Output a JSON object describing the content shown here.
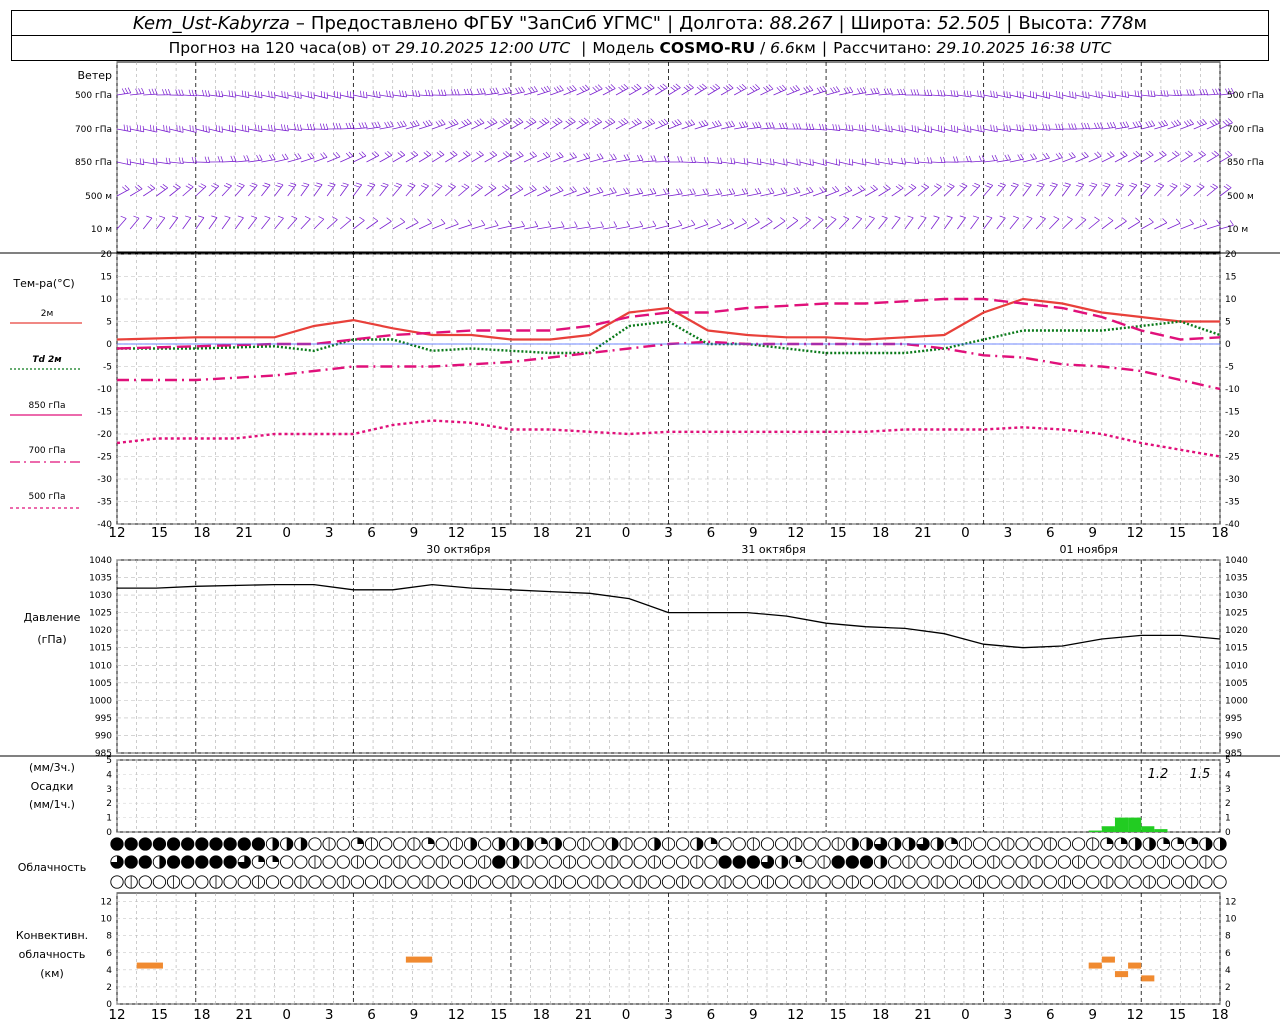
{
  "header": {
    "station": "Kem_Ust-Kabyrza",
    "provider": "Предоставлено ФГБУ \"ЗапСиб УГМС\"",
    "lon_label": "Долгота:",
    "lon": "88.267",
    "lat_label": "Широта:",
    "lat": "52.505",
    "alt_label": "Высота:",
    "alt": "778",
    "alt_unit": "м",
    "forecast_prefix": "Прогноз на 120 часа(ов) от",
    "forecast_start": "29.10.2025 12:00 UTC",
    "model_prefix": "Модель",
    "model": "COSMO-RU",
    "model_res": "6.6",
    "model_res_unit": "км",
    "computed_label": "Рассчитано:",
    "computed": "29.10.2025 16:38 UTC"
  },
  "wind_panel": {
    "title": "Ветер",
    "levels": [
      "500 гПа",
      "700 гПа",
      "850 гПа",
      "500 м",
      "10 м"
    ],
    "barb_color": "#7a1fd0"
  },
  "temp_panel": {
    "title": "Тем-ра(°С)",
    "legend": [
      {
        "label": "2м",
        "color": "#e8403a",
        "style": "solid"
      },
      {
        "label": "Td 2м",
        "color": "#0a7a1a",
        "style": "dotted"
      },
      {
        "label": "850 гПа",
        "color": "#e0107a",
        "style": "long-dash"
      },
      {
        "label": "700 гПа",
        "color": "#e0107a",
        "style": "dash-dot"
      },
      {
        "label": "500 гПа",
        "color": "#e0107a",
        "style": "short-dash"
      }
    ]
  },
  "pressure_panel": {
    "title": "Давление",
    "unit": "(гПа)"
  },
  "precip_panel": {
    "unit_top": "(мм/3ч.)",
    "title": "Осадки",
    "unit_bottom": "(мм/1ч.)",
    "annotations": [
      "1.2",
      "1.5"
    ],
    "bar_color": "#22cc22"
  },
  "cloud_panel": {
    "title": "Облачность"
  },
  "conv_panel": {
    "title_lines": [
      "Конвективн.",
      "облачность",
      "(км)"
    ],
    "bar_color": "#f08a30"
  },
  "time_axis": {
    "hour_ticks": [
      "12",
      "15",
      "18",
      "21",
      "0",
      "3",
      "6",
      "9",
      "12",
      "15",
      "18",
      "21",
      "0",
      "3",
      "6",
      "9",
      "12",
      "15",
      "18",
      "21",
      "0",
      "3",
      "6",
      "9",
      "12",
      "15",
      "18"
    ],
    "dates": [
      {
        "label": "30 октября",
        "at_hour": 24
      },
      {
        "label": "31 октября",
        "at_hour": 48
      },
      {
        "label": "01 ноября",
        "at_hour": 72
      }
    ]
  },
  "chart_data": [
    {
      "type": "line",
      "id": "temperature",
      "ylim": [
        -40,
        20
      ],
      "y_ticks": [
        20,
        15,
        10,
        5,
        0,
        -5,
        -10,
        -15,
        -20,
        -25,
        -30,
        -35,
        -40
      ],
      "x_unit": "hours since 29.10.2025 12:00 UTC",
      "series": [
        {
          "name": "2м",
          "color": "#e8403a",
          "style": "solid",
          "points": [
            [
              0,
              1
            ],
            [
              12,
              1.5
            ],
            [
              24,
              1.5
            ],
            [
              30,
              4
            ],
            [
              36,
              5.3
            ],
            [
              42,
              3.5
            ],
            [
              48,
              2
            ],
            [
              54,
              2
            ],
            [
              60,
              1
            ],
            [
              66,
              1
            ],
            [
              72,
              2
            ],
            [
              78,
              7
            ],
            [
              84,
              8
            ],
            [
              90,
              3
            ],
            [
              96,
              2
            ],
            [
              102,
              1.5
            ],
            [
              108,
              1.5
            ],
            [
              114,
              1
            ],
            [
              120,
              1.5
            ],
            [
              126,
              2
            ],
            [
              132,
              7
            ],
            [
              138,
              10
            ],
            [
              144,
              9
            ],
            [
              150,
              7
            ],
            [
              156,
              6
            ],
            [
              162,
              5
            ],
            [
              168,
              5
            ]
          ]
        },
        {
          "name": "Td 2м",
          "color": "#0a7a1a",
          "style": "dotted",
          "points": [
            [
              0,
              -1
            ],
            [
              12,
              -1
            ],
            [
              24,
              -0.5
            ],
            [
              30,
              -1.5
            ],
            [
              36,
              1
            ],
            [
              42,
              1
            ],
            [
              48,
              -1.5
            ],
            [
              54,
              -1
            ],
            [
              60,
              -1.5
            ],
            [
              66,
              -2
            ],
            [
              72,
              -2
            ],
            [
              78,
              4
            ],
            [
              84,
              5
            ],
            [
              90,
              0
            ],
            [
              96,
              0
            ],
            [
              102,
              -1
            ],
            [
              108,
              -2
            ],
            [
              114,
              -2
            ],
            [
              120,
              -2
            ],
            [
              126,
              -1
            ],
            [
              132,
              1
            ],
            [
              138,
              3
            ],
            [
              144,
              3
            ],
            [
              150,
              3
            ],
            [
              156,
              4
            ],
            [
              162,
              5
            ],
            [
              168,
              2
            ]
          ]
        },
        {
          "name": "850 гПа",
          "color": "#e0107a",
          "style": "long-dash",
          "points": [
            [
              0,
              -1
            ],
            [
              12,
              -0.5
            ],
            [
              24,
              0
            ],
            [
              30,
              0
            ],
            [
              36,
              1
            ],
            [
              42,
              2
            ],
            [
              48,
              2.5
            ],
            [
              54,
              3
            ],
            [
              60,
              3
            ],
            [
              66,
              3
            ],
            [
              72,
              4
            ],
            [
              78,
              6
            ],
            [
              84,
              7
            ],
            [
              90,
              7
            ],
            [
              96,
              8
            ],
            [
              102,
              8.5
            ],
            [
              108,
              9
            ],
            [
              114,
              9
            ],
            [
              120,
              9.5
            ],
            [
              126,
              10
            ],
            [
              132,
              10
            ],
            [
              138,
              9
            ],
            [
              144,
              8
            ],
            [
              150,
              6
            ],
            [
              156,
              3
            ],
            [
              162,
              1
            ],
            [
              168,
              1.5
            ]
          ]
        },
        {
          "name": "700 гПа",
          "color": "#e0107a",
          "style": "dash-dot",
          "points": [
            [
              0,
              -8
            ],
            [
              12,
              -8
            ],
            [
              24,
              -7
            ],
            [
              30,
              -6
            ],
            [
              36,
              -5
            ],
            [
              42,
              -5
            ],
            [
              48,
              -5
            ],
            [
              54,
              -4.5
            ],
            [
              60,
              -4
            ],
            [
              66,
              -3
            ],
            [
              72,
              -2
            ],
            [
              78,
              -1
            ],
            [
              84,
              0
            ],
            [
              90,
              0.5
            ],
            [
              96,
              0
            ],
            [
              102,
              0
            ],
            [
              108,
              0
            ],
            [
              114,
              0
            ],
            [
              120,
              0
            ],
            [
              126,
              -1
            ],
            [
              132,
              -2.5
            ],
            [
              138,
              -3
            ],
            [
              144,
              -4.5
            ],
            [
              150,
              -5
            ],
            [
              156,
              -6
            ],
            [
              162,
              -8
            ],
            [
              168,
              -10
            ]
          ]
        },
        {
          "name": "500 гПа",
          "color": "#e0107a",
          "style": "short-dash",
          "points": [
            [
              0,
              -22
            ],
            [
              6,
              -21
            ],
            [
              12,
              -21
            ],
            [
              18,
              -21
            ],
            [
              24,
              -20
            ],
            [
              30,
              -20
            ],
            [
              36,
              -20
            ],
            [
              42,
              -18
            ],
            [
              48,
              -17
            ],
            [
              54,
              -17.5
            ],
            [
              60,
              -19
            ],
            [
              66,
              -19
            ],
            [
              72,
              -19.5
            ],
            [
              78,
              -20
            ],
            [
              84,
              -19.5
            ],
            [
              90,
              -19.5
            ],
            [
              96,
              -19.5
            ],
            [
              102,
              -19.5
            ],
            [
              108,
              -19.5
            ],
            [
              114,
              -19.5
            ],
            [
              120,
              -19
            ],
            [
              126,
              -19
            ],
            [
              132,
              -19
            ],
            [
              138,
              -18.5
            ],
            [
              144,
              -19
            ],
            [
              150,
              -20
            ],
            [
              156,
              -22
            ],
            [
              162,
              -23.5
            ],
            [
              168,
              -25
            ]
          ]
        }
      ]
    },
    {
      "type": "line",
      "id": "pressure",
      "ylim": [
        985,
        1040
      ],
      "y_ticks": [
        1040,
        1035,
        1030,
        1025,
        1020,
        1015,
        1010,
        1005,
        1000,
        995,
        990,
        985
      ],
      "series": [
        {
          "name": "",
          "color": "#000000",
          "points": [
            [
              0,
              1032
            ],
            [
              6,
              1032
            ],
            [
              12,
              1032.5
            ],
            [
              24,
              1033
            ],
            [
              30,
              1033
            ],
            [
              36,
              1031.5
            ],
            [
              42,
              1031.5
            ],
            [
              48,
              1033
            ],
            [
              54,
              1032
            ],
            [
              60,
              1031.5
            ],
            [
              66,
              1031
            ],
            [
              72,
              1030.5
            ],
            [
              78,
              1029
            ],
            [
              84,
              1025
            ],
            [
              90,
              1025
            ],
            [
              96,
              1025
            ],
            [
              102,
              1024
            ],
            [
              108,
              1022
            ],
            [
              114,
              1021
            ],
            [
              120,
              1020.5
            ],
            [
              126,
              1019
            ],
            [
              132,
              1016
            ],
            [
              138,
              1015
            ],
            [
              144,
              1015.5
            ],
            [
              150,
              1017.5
            ],
            [
              156,
              1018.5
            ],
            [
              162,
              1018.5
            ],
            [
              168,
              1017.5
            ]
          ]
        }
      ]
    },
    {
      "type": "bar",
      "id": "precipitation",
      "ylim": [
        0,
        5
      ],
      "y_ticks": [
        5,
        4,
        3,
        2,
        1,
        0
      ],
      "bars": [
        [
          148,
          0.1
        ],
        [
          150,
          0.4
        ],
        [
          152,
          1
        ],
        [
          154,
          1
        ],
        [
          156,
          0.4
        ],
        [
          158,
          0.2
        ]
      ]
    },
    {
      "type": "bar",
      "id": "convective_cloud",
      "ylim": [
        0,
        13
      ],
      "y_ticks": [
        12,
        10,
        8,
        6,
        4,
        2,
        0
      ],
      "segments": [
        [
          3,
          7,
          4.5
        ],
        [
          44,
          48,
          5.2
        ],
        [
          148,
          150,
          4.5
        ],
        [
          150,
          152,
          5.2
        ],
        [
          152,
          154,
          3.5
        ],
        [
          154,
          156,
          4.5
        ],
        [
          156,
          158,
          3
        ]
      ]
    },
    {
      "type": "table",
      "id": "cloud_cover",
      "rows": 3,
      "note": "cover symbols, fraction of circle filled (0=clear, 1=overcast)",
      "row_top": [
        1,
        1,
        1,
        1,
        1,
        1,
        1,
        1,
        1,
        1,
        1,
        0.5,
        0.5,
        0.5,
        0,
        0,
        0,
        0.25,
        0,
        0,
        0,
        0,
        0.25,
        0,
        0,
        0.5,
        0,
        0.5,
        0.5,
        0.5,
        0.25,
        0.5,
        0,
        0,
        0,
        0.5,
        0,
        0,
        0.5,
        0,
        0,
        0.5,
        0.25,
        0,
        0,
        0,
        0,
        0,
        0,
        0,
        0,
        0,
        0.5,
        0.5,
        0.75,
        0.5,
        0.5,
        0.75,
        0.5,
        0.25,
        0,
        0,
        0,
        0,
        0,
        0,
        0,
        0,
        0,
        0,
        0.25,
        0.25,
        0.5,
        0.5,
        0.25,
        0.25,
        0.25,
        0.5,
        0.5,
        0.5,
        0.5,
        0.5,
        0.5,
        1,
        1,
        1,
        0.25,
        0.5,
        0.5,
        0,
        0.5,
        0.5,
        0.75,
        0.5,
        0.5,
        0.5,
        0.5,
        0.5
      ],
      "row_mid": [
        0.75,
        1,
        1,
        0.5,
        1,
        1,
        1,
        1,
        1,
        0.75,
        0.25,
        0.25,
        0,
        0,
        0,
        0,
        0,
        0,
        0,
        0,
        0,
        0,
        0,
        0,
        0,
        0,
        0,
        1,
        0.5,
        0,
        0,
        0,
        0,
        0,
        0,
        0,
        0,
        0,
        0,
        0,
        0,
        0,
        0,
        1,
        1,
        1,
        0.75,
        0.5,
        0.25,
        0,
        0,
        1,
        1,
        1,
        0.5,
        0,
        0,
        0,
        0,
        0,
        0,
        0,
        0,
        0,
        0,
        0,
        0,
        0,
        0,
        0,
        0,
        0,
        0,
        0,
        0,
        0,
        0,
        0,
        0,
        0,
        0,
        0,
        0,
        0,
        0,
        0,
        0.25,
        0,
        0,
        0.25,
        0.25,
        0.5,
        0.25,
        0.75,
        0.5,
        0.5,
        0.5,
        0.75
      ],
      "row_bot": [
        0,
        0,
        0,
        0,
        0,
        0,
        0,
        0,
        0,
        0,
        0,
        0,
        0,
        0,
        0,
        0,
        0,
        0,
        0,
        0,
        0,
        0,
        0,
        0,
        0,
        0,
        0,
        0,
        0,
        0,
        0,
        0,
        0,
        0,
        0,
        0,
        0,
        0,
        0,
        0,
        0,
        0,
        0,
        0,
        0,
        0,
        0,
        0,
        0,
        0,
        0,
        0,
        0,
        0,
        0,
        0,
        0,
        0,
        0,
        0,
        0,
        0,
        0,
        0,
        0,
        0,
        0,
        0,
        0,
        0,
        0,
        0,
        0,
        0,
        0,
        0,
        0,
        0,
        0,
        0,
        0,
        0,
        0,
        0,
        0,
        0,
        0,
        0,
        0,
        0,
        0.5,
        0.5,
        0.75,
        0.75,
        1,
        1,
        0.75,
        0.5
      ]
    }
  ]
}
